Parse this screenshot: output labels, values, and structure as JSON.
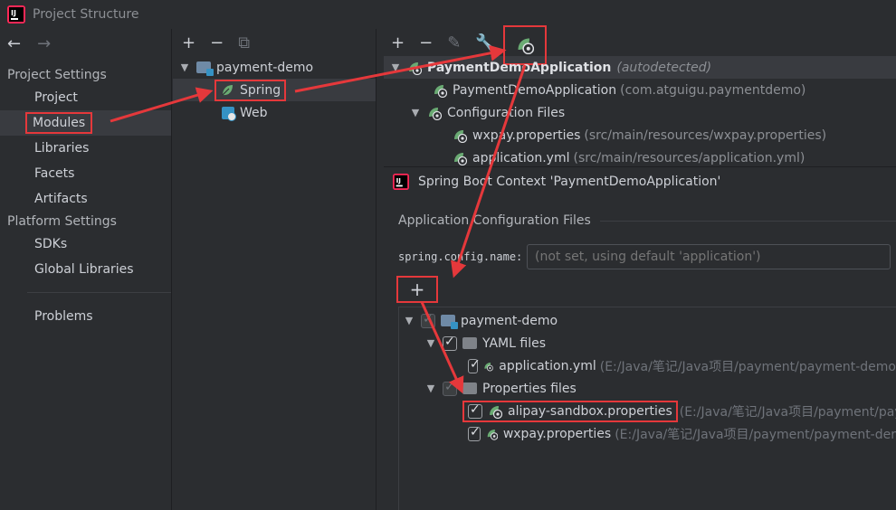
{
  "window": {
    "title": "Project Structure"
  },
  "left_panel": {
    "section_project": "Project Settings",
    "project_items": [
      {
        "label": "Project"
      },
      {
        "label": "Modules"
      },
      {
        "label": "Libraries"
      },
      {
        "label": "Facets"
      },
      {
        "label": "Artifacts"
      }
    ],
    "section_platform": "Platform Settings",
    "platform_items": [
      {
        "label": "SDKs"
      },
      {
        "label": "Global Libraries"
      }
    ],
    "problems": "Problems"
  },
  "module_tree": {
    "root": "payment-demo",
    "children": [
      {
        "label": "Spring"
      },
      {
        "label": "Web"
      }
    ]
  },
  "facet_tree": {
    "app_name": "PaymentDemoApplication",
    "app_note": "(autodetected)",
    "main_class": "PaymentDemoApplication",
    "main_package": "(com.atguigu.paymentdemo)",
    "config_files_label": "Configuration Files",
    "config_files": [
      {
        "name": "wxpay.properties",
        "path": "(src/main/resources/wxpay.properties)"
      },
      {
        "name": "application.yml",
        "path": "(src/main/resources/application.yml)"
      }
    ]
  },
  "context_panel": {
    "title": "Spring Boot Context 'PaymentDemoApplication'",
    "group_title": "Application Configuration Files",
    "field_label": "spring.config.name:",
    "field_placeholder": "(not set, using default 'application')",
    "add_symbol": "+"
  },
  "files_tree": {
    "root": "payment-demo",
    "yaml_group": "YAML files",
    "yaml_file": {
      "name": "application.yml",
      "path": "(E:/Java/笔记/Java项目/payment/payment-demo"
    },
    "props_group": "Properties files",
    "props_files": [
      {
        "name": "alipay-sandbox.properties",
        "path": "(E:/Java/笔记/Java项目/payment/pay"
      },
      {
        "name": "wxpay.properties",
        "path": "(E:/Java/笔记/Java项目/payment/payment-der"
      }
    ]
  },
  "colors": {
    "accent_red": "#e5383b",
    "spring_green": "#6aab73",
    "folder_blue": "#3592c4"
  }
}
